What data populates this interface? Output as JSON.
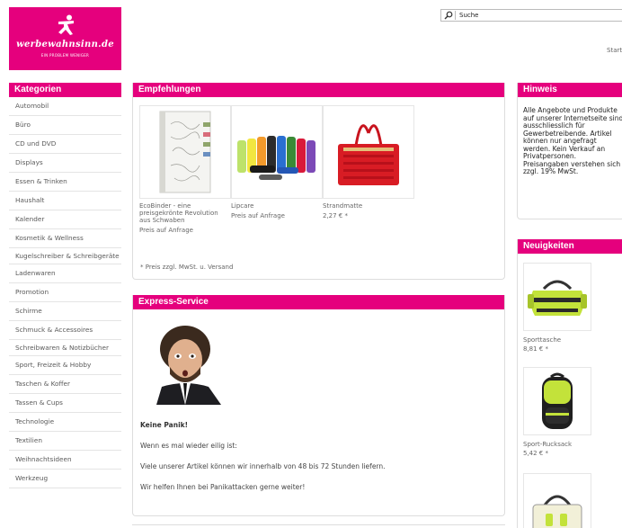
{
  "logo": {
    "brand": "werbewahnsinn.de",
    "tagline": "EIN PROBLEM WENIGER"
  },
  "search": {
    "value": "Suche"
  },
  "header": {
    "start_link": "Start"
  },
  "sidebar": {
    "title": "Kategorien",
    "items": [
      "Automobil",
      "Büro",
      "CD und DVD",
      "Displays",
      "Essen & Trinken",
      "Haushalt",
      "Kalender",
      "Kosmetik & Wellness",
      "Kugelschreiber & Schreibgeräte",
      "Ladenwaren",
      "Promotion",
      "Schirme",
      "Schmuck & Accessoires",
      "Schreibwaren & Notizbücher",
      "Sport, Freizeit & Hobby",
      "Taschen & Koffer",
      "Tassen & Cups",
      "Technologie",
      "Textilien",
      "Weihnachtsideen",
      "Werkzeug"
    ]
  },
  "recommendations": {
    "title": "Empfehlungen",
    "products": [
      {
        "name": "EcoBinder - eine preisgekrönte Revolution aus Schwaben",
        "price": "Preis auf Anfrage"
      },
      {
        "name": "Lipcare",
        "price": "Preis auf Anfrage"
      },
      {
        "name": "Strandmatte",
        "price": "2,27 € *"
      }
    ],
    "note": "* Preis zzgl. MwSt. u. Versand"
  },
  "express": {
    "title": "Express-Service",
    "lines": [
      "Keine Panik!",
      "Wenn es mal wieder eilig ist:",
      "Viele unserer Artikel können wir innerhalb von 48 bis 72 Stunden liefern.",
      "Wir helfen Ihnen bei Panikattacken gerne weiter!"
    ]
  },
  "hint": {
    "title": "Hinweis",
    "text": "Alle Angebote und Produkte auf unserer Internetseite sind ausschliesslich für Gewerbetreibende. Artikel können nur angefragt werden. Kein Verkauf an Privatpersonen. Preisangaben verstehen sich zzgl. 19% MwSt."
  },
  "news": {
    "title": "Neuigkeiten",
    "items": [
      {
        "name": "Sporttasche",
        "price": "8,81 € *"
      },
      {
        "name": "Sport-Rucksack",
        "price": "5,42 € *"
      },
      {
        "name": "",
        "price": ""
      }
    ]
  },
  "colors": {
    "accent": "#e5007d"
  }
}
